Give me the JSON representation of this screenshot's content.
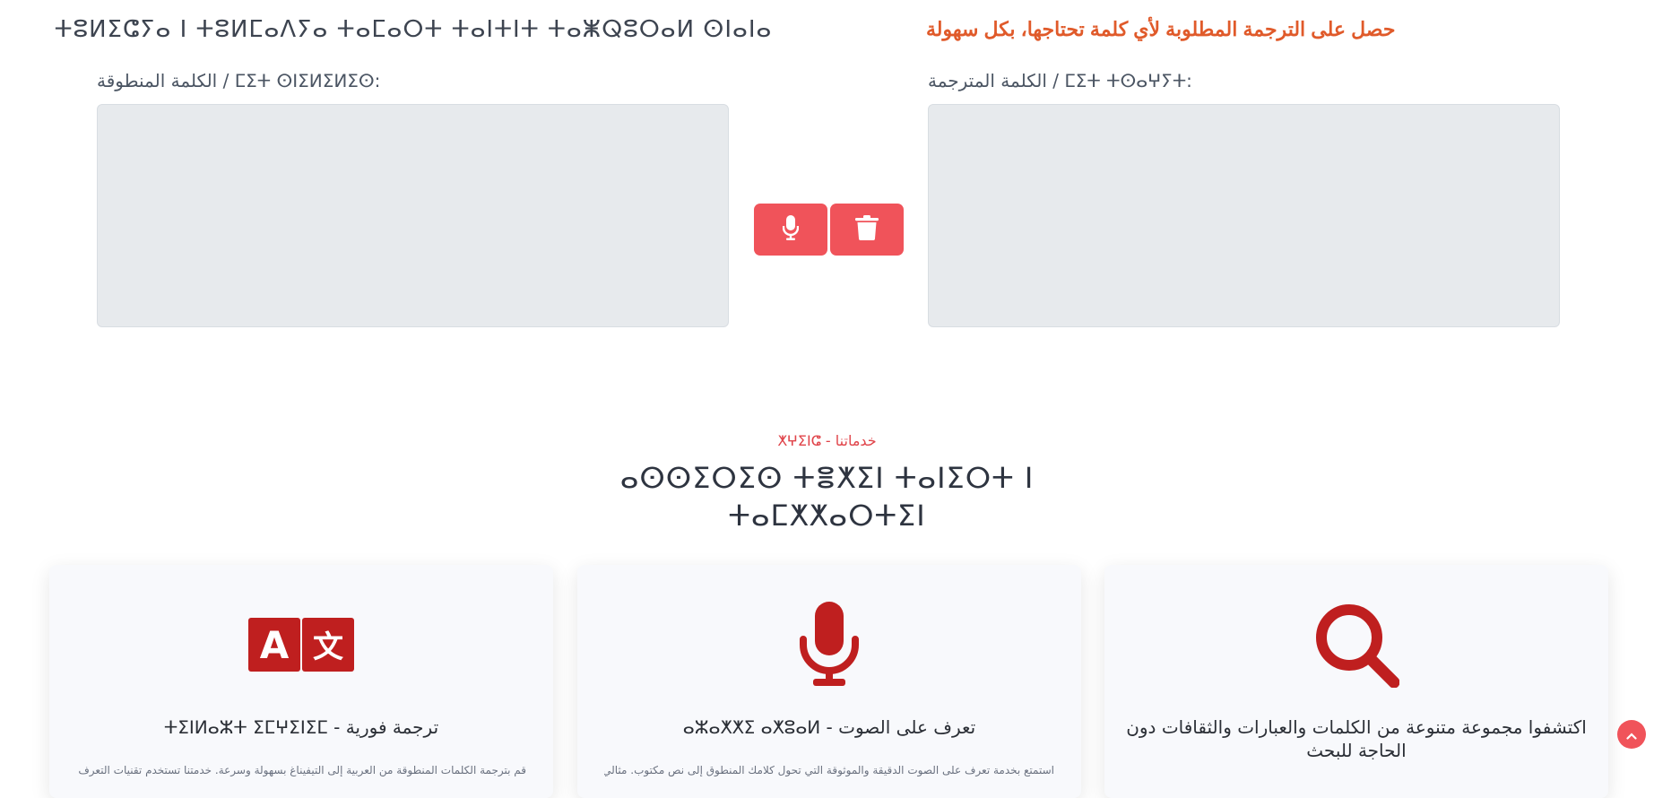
{
  "header": {
    "tifinagh_title": "ⵜⵓⵍⵉⵛⵢⴰ ⵏ ⵜⵓⵍⵎⴰⴷⵢⴰ ⵜⴰⵎⴰⵔⵜ ⵜⴰⵏⵜⵏⵜ ⵜⴰⵥⵕⵓⵔⴰⵍ ⵙⵏⴰⵏⴰ",
    "arabic_subtitle": "حصل على الترجمة المطلوبة لأي كلمة تحتاجها، بكل سهولة"
  },
  "translator": {
    "spoken_label": "الكلمة المنطوقة / ⵎⵉⵜ ⵙⵏⵉⵍⵉⵍⵉⵙ:",
    "translated_label": "الكلمة المترجمة / ⵎⵉⵜ ⵜⵙⴰⵖⵢⵜ:",
    "spoken_value": "",
    "translated_value": ""
  },
  "icons": {
    "mic": "microphone-icon",
    "trash": "trash-icon",
    "translate": "translate-icon",
    "search": "search-icon",
    "scroll_up": "chevron-up-icon"
  },
  "services": {
    "tag": "ⵅⵖⵉⵏⵛ - خدماتنا",
    "title_line1": "ⴰⵙⵙⵉⵔⵉⵙ ⵜⴻⵅⵉⵏ ⵜⴰⵏⵉⵔⵜ ⵏ",
    "title_line2": "ⵜⴰⵎⵅⵅⴰⵔⵜⵉⵏ",
    "cards": [
      {
        "title": "ⵜⵉⵏⵍⴰⵣⵜ ⵉⵎⵖⵉⵏⵉⵎ - ترجمة فورية",
        "text": "قم بترجمة الكلمات المنطوقة من العربية إلى التيفيناغ بسهولة وسرعة. خدمتنا تستخدم تقنيات التعرف على"
      },
      {
        "title": "ⴰⵣⴰⵅⵅⵉ ⴰⵅⵓⴰⵍ - تعرف على الصوت",
        "text": "استمتع بخدمة تعرف على الصوت الدقيقة والموثوقة التي تحول كلامك المنطوق إلى نص مكتوب. مثالي"
      },
      {
        "title": "اكتشفوا مجموعة متنوعة من الكلمات والعبارات والثقافات دون الحاجة للبحث",
        "text": ""
      }
    ]
  },
  "colors": {
    "accent": "#f0535a",
    "heading_orange": "#e05a2a",
    "icon_red": "#bf1f1f",
    "field_bg": "#e7eaed"
  }
}
